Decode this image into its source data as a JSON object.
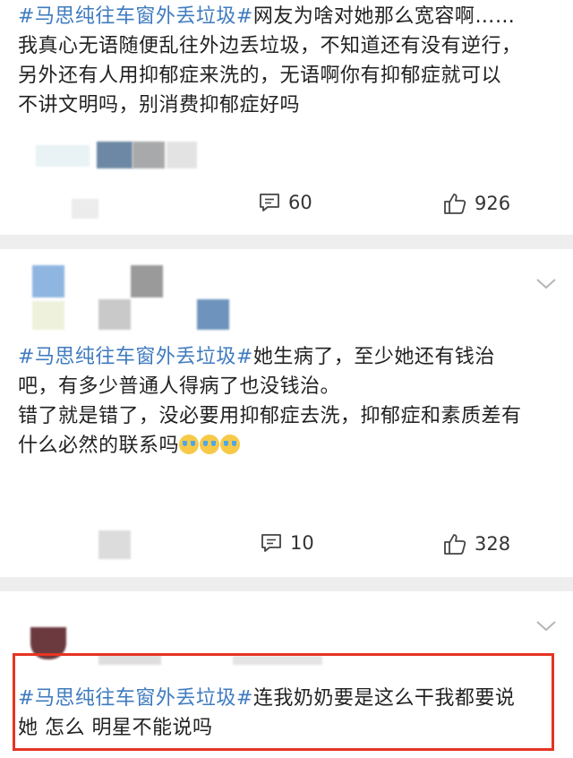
{
  "posts": [
    {
      "hashtag": "#马思纯往车窗外丢垃圾#",
      "lines": [
        "网友为啥对她那么宽容啊……",
        "我真心无语随便乱往外边丢垃圾，不知道还有没有逆行，",
        "另外还有人用抑郁症来洗的，无语啊你有抑郁症就可以",
        "不讲文明吗，别消费抑郁症好吗"
      ],
      "comments_count": "60",
      "likes_count": "926"
    },
    {
      "hashtag": "#马思纯往车窗外丢垃圾#",
      "lines": [
        "她生病了，至少她还有钱治",
        "吧，有多少普通人得病了也没钱治。",
        "错了就是错了，没必要用抑郁症去洗，抑郁症和素质差有",
        "什么必然的联系吗"
      ],
      "comments_count": "10",
      "likes_count": "328"
    },
    {
      "hashtag": "#马思纯往车窗外丢垃圾#",
      "lines": [
        "连我奶奶要是这么干我都要说",
        "她 怎么 明星不能说吗"
      ]
    }
  ],
  "icons": {
    "comment": "comment-icon",
    "like": "thumbs-up-icon",
    "more": "chevron-down-icon",
    "emoji": "crying-face-icon"
  },
  "colors": {
    "hashtag": "#3f7bbf",
    "highlight_border": "#e63322",
    "separator": "#eeeeee"
  }
}
